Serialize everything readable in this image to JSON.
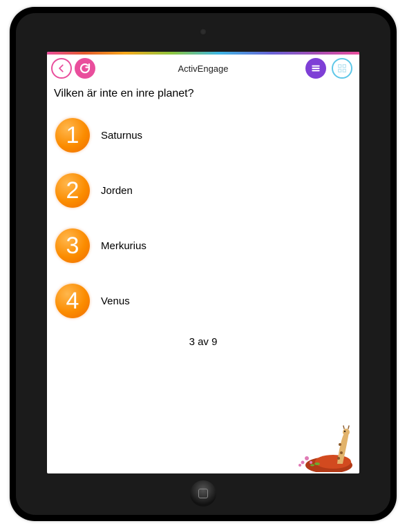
{
  "header": {
    "title": "ActivEngage"
  },
  "question": "Vilken är inte en inre planet?",
  "options": [
    {
      "num": "1",
      "label": "Saturnus"
    },
    {
      "num": "2",
      "label": "Jorden"
    },
    {
      "num": "3",
      "label": "Merkurius"
    },
    {
      "num": "4",
      "label": "Venus"
    }
  ],
  "progress": "3 av 9"
}
